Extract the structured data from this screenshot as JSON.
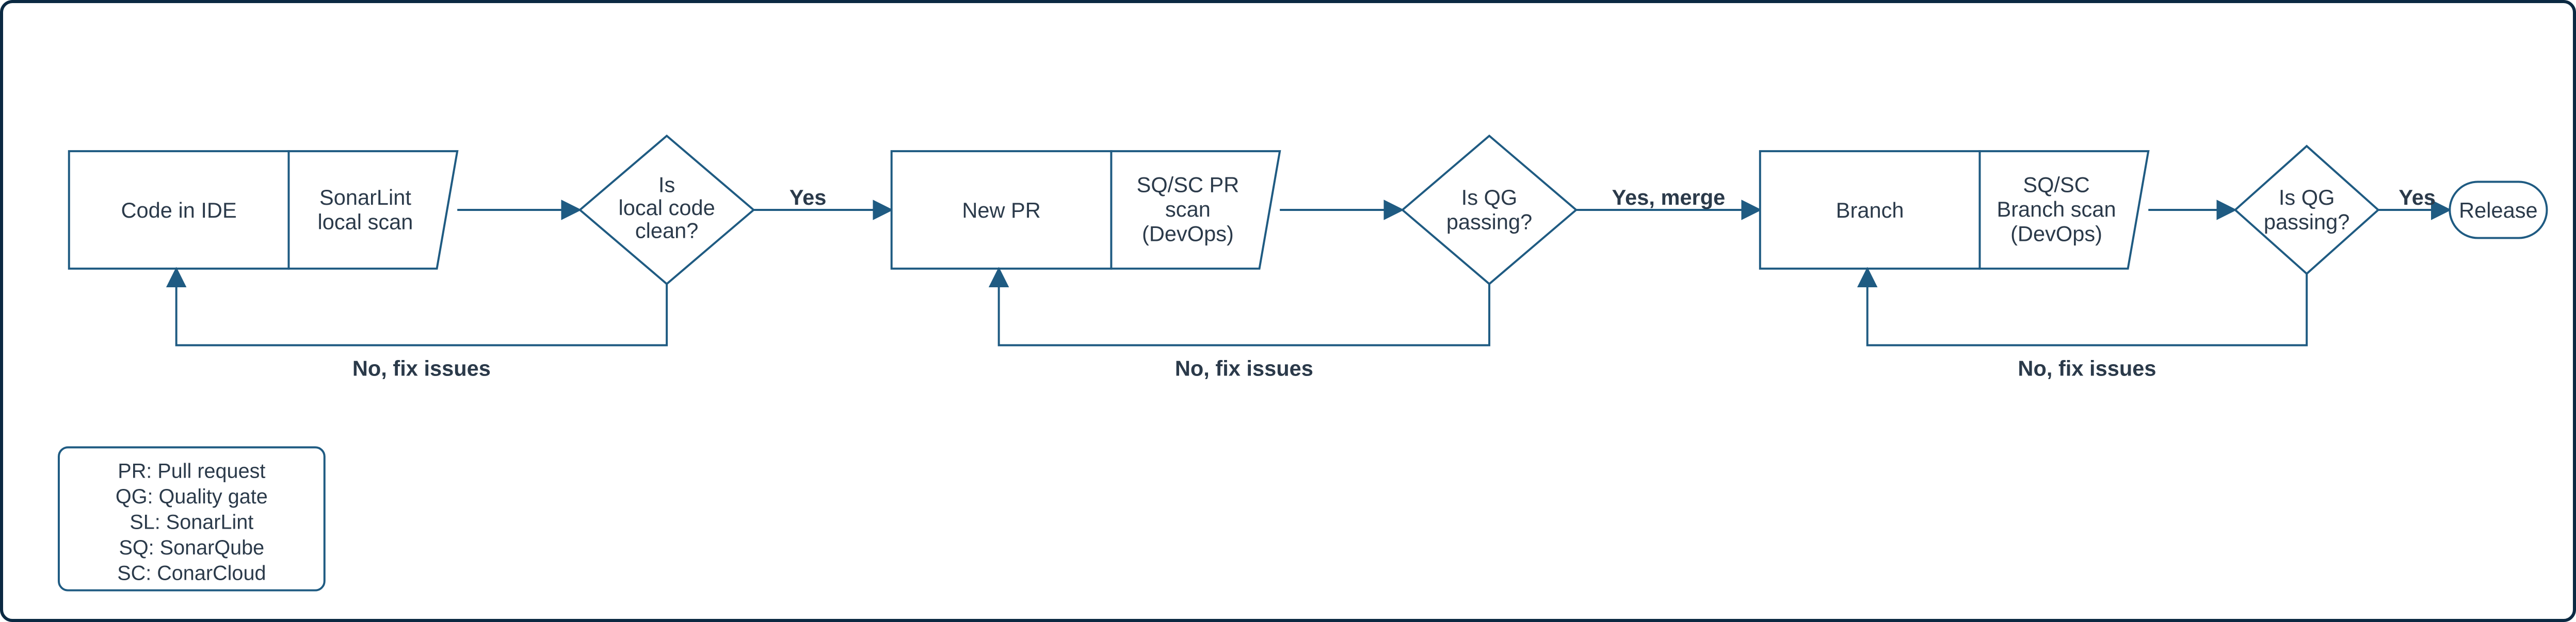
{
  "colors": {
    "stroke": "#1f5b82",
    "text": "#2b3a4a",
    "fill": "#ffffff"
  },
  "nodes": {
    "code_in_ide": "Code in IDE",
    "sonarlint_scan_l1": "SonarLint",
    "sonarlint_scan_l2": "local scan",
    "is_local_clean_l1": "Is",
    "is_local_clean_l2": "local code",
    "is_local_clean_l3": "clean?",
    "new_pr": "New PR",
    "sqsc_pr_l1": "SQ/SC PR",
    "sqsc_pr_l2": "scan",
    "sqsc_pr_l3": "(DevOps)",
    "is_qg1_l1": "Is QG",
    "is_qg1_l2": "passing?",
    "branch": "Branch",
    "sqsc_branch_l1": "SQ/SC",
    "sqsc_branch_l2": "Branch scan",
    "sqsc_branch_l3": "(DevOps)",
    "is_qg2_l1": "Is QG",
    "is_qg2_l2": "passing?",
    "release": "Release"
  },
  "edges": {
    "yes1": "Yes",
    "no1": "No, fix issues",
    "yes2": "Yes, merge",
    "no2": "No, fix issues",
    "yes3": "Yes",
    "no3": "No, fix issues"
  },
  "legend": {
    "pr": "PR: Pull request",
    "qg": "QG: Quality gate",
    "sl": "SL: SonarLint",
    "sq": "SQ: SonarQube",
    "sc": "SC: ConarCloud"
  }
}
